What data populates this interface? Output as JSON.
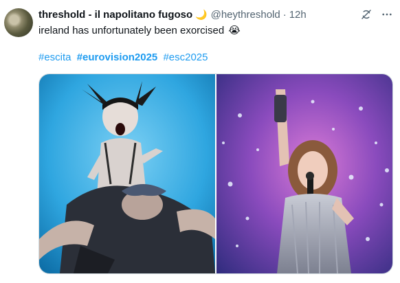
{
  "tweet": {
    "author": {
      "display_name": "threshold - il napolitano fugoso",
      "name_emoji": "🌙",
      "handle": "@heythreshold",
      "separator": "·",
      "time": "12h"
    },
    "text": "ireland has unfortunately been exorcised",
    "text_emoji": "😭",
    "hashtags": [
      "#escita",
      "#eurovision2025",
      "#esc2025"
    ],
    "icons": {
      "grok": "grok-icon",
      "more": "more-icon"
    },
    "media": [
      {
        "name": "photo-left",
        "description_icon": "performer-horns-stage"
      },
      {
        "name": "photo-right",
        "description_icon": "performer-sparkle-stage"
      }
    ],
    "colors": {
      "link": "#1d9bf0",
      "secondary_text": "#536471",
      "border": "#cfd9de"
    }
  }
}
